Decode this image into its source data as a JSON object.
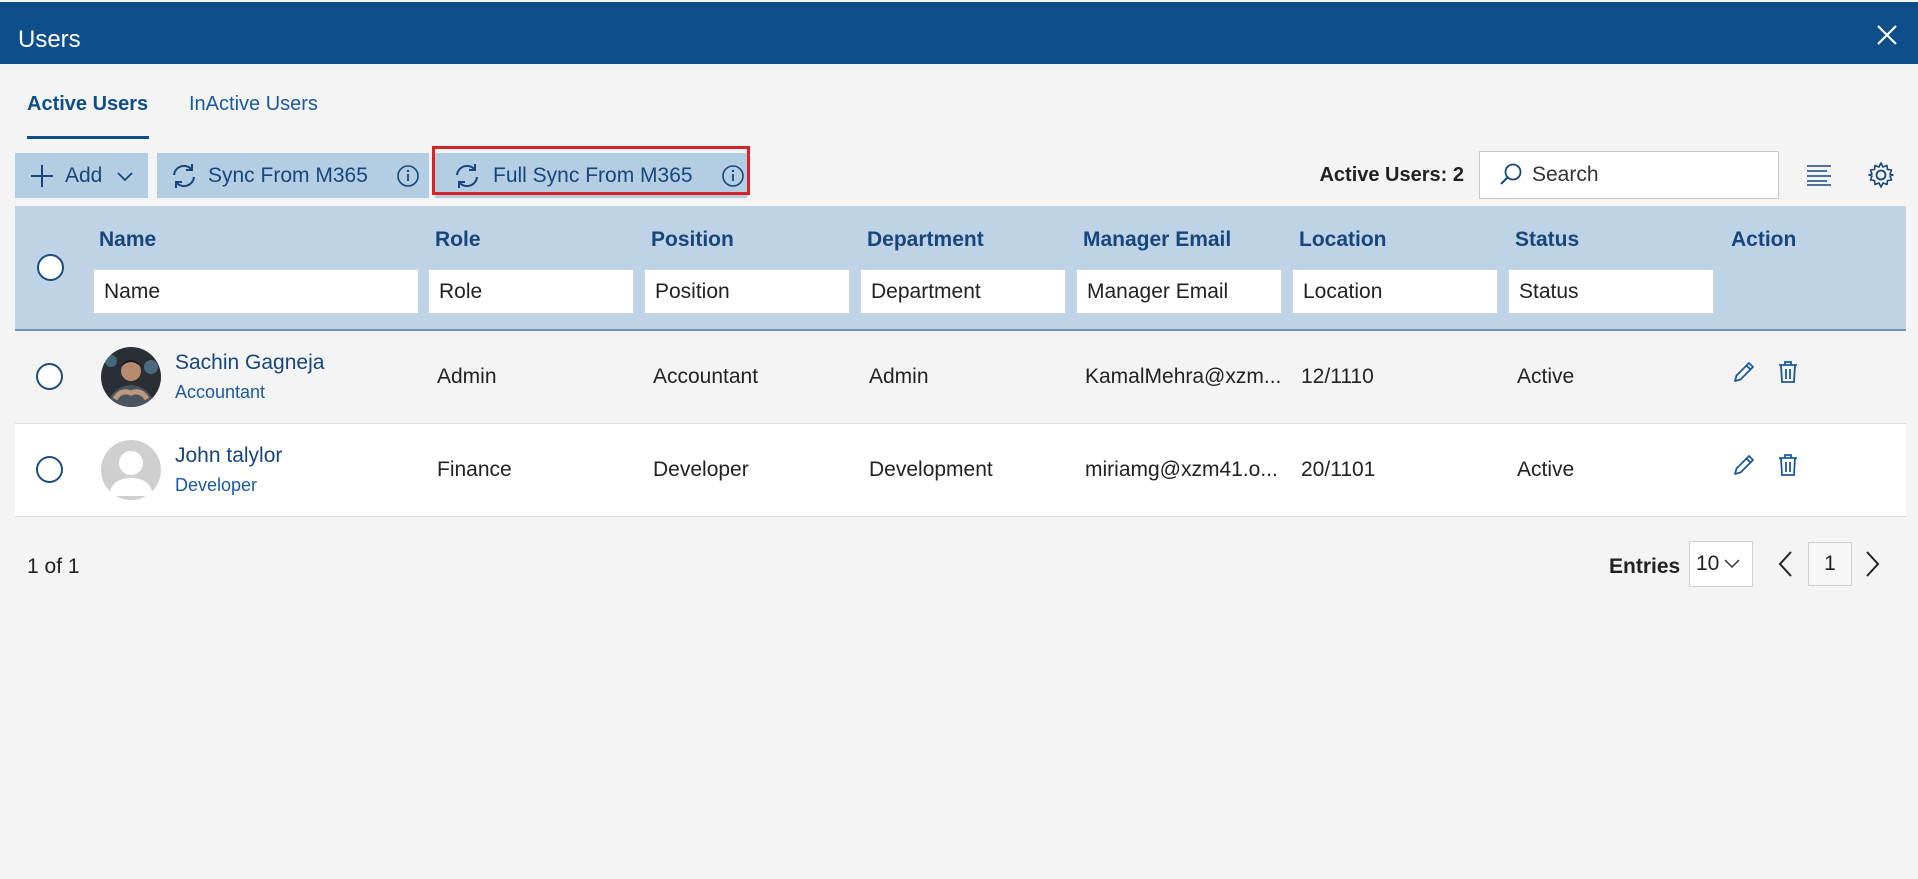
{
  "window": {
    "title": "Users"
  },
  "tabs": [
    {
      "label": "Active Users",
      "active": true
    },
    {
      "label": "InActive Users",
      "active": false
    }
  ],
  "toolbar": {
    "add_label": "Add",
    "sync_label": "Sync From M365",
    "full_sync_label": "Full Sync From M365",
    "active_users_label": "Active Users: 2",
    "search_placeholder": "Search"
  },
  "columns": [
    {
      "title": "Name",
      "filter": "Name"
    },
    {
      "title": "Role",
      "filter": "Role"
    },
    {
      "title": "Position",
      "filter": "Position"
    },
    {
      "title": "Department",
      "filter": "Department"
    },
    {
      "title": "Manager Email",
      "filter": "Manager Email"
    },
    {
      "title": "Location",
      "filter": "Location"
    },
    {
      "title": "Status",
      "filter": "Status"
    },
    {
      "title": "Action"
    }
  ],
  "rows": [
    {
      "name": "Sachin Gagneja",
      "subtitle": "Accountant",
      "role": "Admin",
      "position": "Accountant",
      "department": "Admin",
      "manager_email": "KamalMehra@xzm...",
      "location": "12/1110",
      "status": "Active",
      "avatar": "photo"
    },
    {
      "name": "John talylor",
      "subtitle": "Developer",
      "role": "Finance",
      "position": "Developer",
      "department": "Development",
      "manager_email": "miriamg@xzm41.o...",
      "location": "20/1101",
      "status": "Active",
      "avatar": "placeholder"
    }
  ],
  "pagination": {
    "info": "1 of 1",
    "entries_label": "Entries",
    "entries_value": "10",
    "current_page": "1"
  },
  "colors": {
    "header_bg": "#0e4e8b",
    "accent": "#17467d",
    "grid_head_bg": "#bed3e6",
    "button_bg": "#b3cde3",
    "highlight": "#d9232a"
  }
}
